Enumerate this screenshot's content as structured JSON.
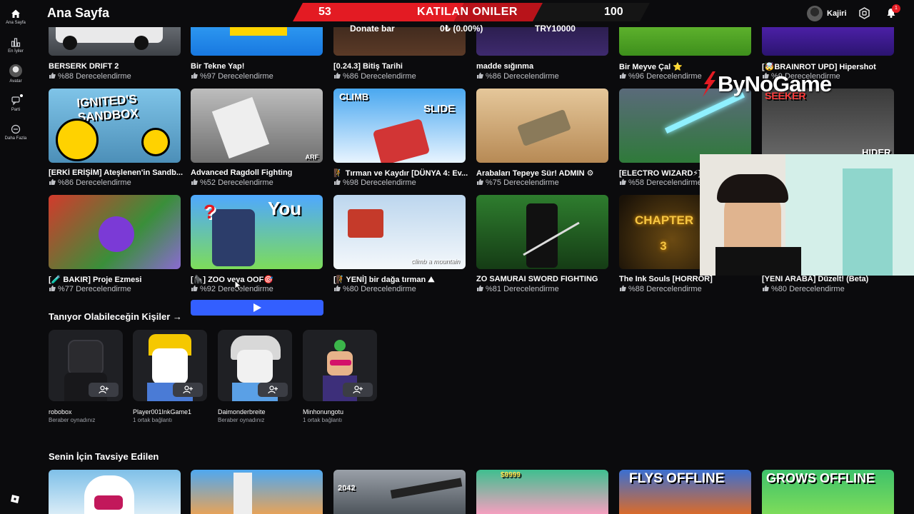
{
  "app": {
    "page_title": "Ana Sayfa"
  },
  "nav": {
    "home": "Ana Sayfa",
    "charts": "En İyiler",
    "avatar": "Avatar",
    "party": "Parti",
    "more": "Daha Fazla"
  },
  "user": {
    "name": "Kajiri",
    "notifications": "1"
  },
  "overlay": {
    "count_left": "53",
    "banner_title": "KATILAN ONILER",
    "count_right": "100",
    "donate_label": "Donate bar",
    "donate_progress": "0₺ (0.00%)",
    "donate_goal": "TRY10000",
    "donate_fraction": 0,
    "logo": "ByNoGame"
  },
  "games_row1": [
    {
      "title": "BERSERK DRIFT 2",
      "rating": "%88 Derecelendirme"
    },
    {
      "title": "Bir Tekne Yap!",
      "rating": "%97 Derecelendirme"
    },
    {
      "title": "[0.24.3] Bitiş Tarihi",
      "rating": "%86 Derecelendirme"
    },
    {
      "title": "madde sığınma",
      "rating": "%86 Derecelendirme"
    },
    {
      "title": "Bir Meyve Çal ⭐",
      "rating": "%96 Derecelendirme"
    },
    {
      "title": "[🤯BRAINROT UPD] Hipershot",
      "rating": "%9 Derecelendirme"
    }
  ],
  "games_row2": [
    {
      "title": "[ERKİ ERİŞİM] Ateşlenen'in Sandb...",
      "rating": "%86 Derecelendirme",
      "art": "IGNITED'S SANDBOX"
    },
    {
      "title": "Advanced Ragdoll Fighting",
      "rating": "%52 Derecelendirme",
      "art": "ARF"
    },
    {
      "title": "🧗 Tırman ve Kaydır [DÜNYA 4: Ev...",
      "rating": "%98 Derecelendirme",
      "art1": "CLIMB",
      "art2": "SLIDE"
    },
    {
      "title": "Arabaları Tepeye Sür! ADMIN ⚙",
      "rating": "%75 Derecelendirme"
    },
    {
      "title": "[ELECTRO WIZARD⚡] ...",
      "rating": "%58 Derecelendirme"
    },
    {
      "title": "",
      "rating": "",
      "art1": "SEEKER",
      "art2": "HIDER"
    }
  ],
  "games_row3": [
    {
      "title": "[🧪 BAKIR] Proje Ezmesi",
      "rating": "%77 Derecelendirme"
    },
    {
      "title": "[🦍] ZOO veya OOF🎯",
      "rating": "%92 Derecelendirme",
      "art": "You"
    },
    {
      "title": "[🧗YENİ] bir dağa tırman ⛰",
      "rating": "%80 Derecelendirme",
      "art": "climb a mountain"
    },
    {
      "title": "ZO SAMURAI SWORD FIGHTING",
      "rating": "%81 Derecelendirme"
    },
    {
      "title": "The Ink Souls [HORROR]",
      "rating": "%88 Derecelendirme",
      "art": "CHAPTER 3"
    },
    {
      "title": "[YENİ ARABA] Düzelt! (Beta)",
      "rating": "%80 Derecelendirme"
    }
  ],
  "friends_section": {
    "title": "Tanıyor Olabileceğin Kişiler →"
  },
  "friends": [
    {
      "name": "robobox",
      "status": "Beraber oynadınız"
    },
    {
      "name": "Player001InkGame1",
      "status": "1 ortak bağlantı"
    },
    {
      "name": "Daimonderbreite",
      "status": "Beraber oynadınız"
    },
    {
      "name": "Minhonungotu",
      "status": "1 ortak bağlantı"
    }
  ],
  "recommended_section": {
    "title": "Senin İçin Tavsiye Edilen"
  },
  "recommended": [
    {
      "art": ""
    },
    {
      "art": ""
    },
    {
      "art": "2042"
    },
    {
      "art": "$9999"
    },
    {
      "art": "FLYS OFFLINE"
    },
    {
      "art": "GROWS OFFLINE"
    }
  ],
  "colors": {
    "background": "#0b0b0d",
    "play_button": "#335fff",
    "banner_red": "#e31b23",
    "notif_red": "#e31b23"
  }
}
